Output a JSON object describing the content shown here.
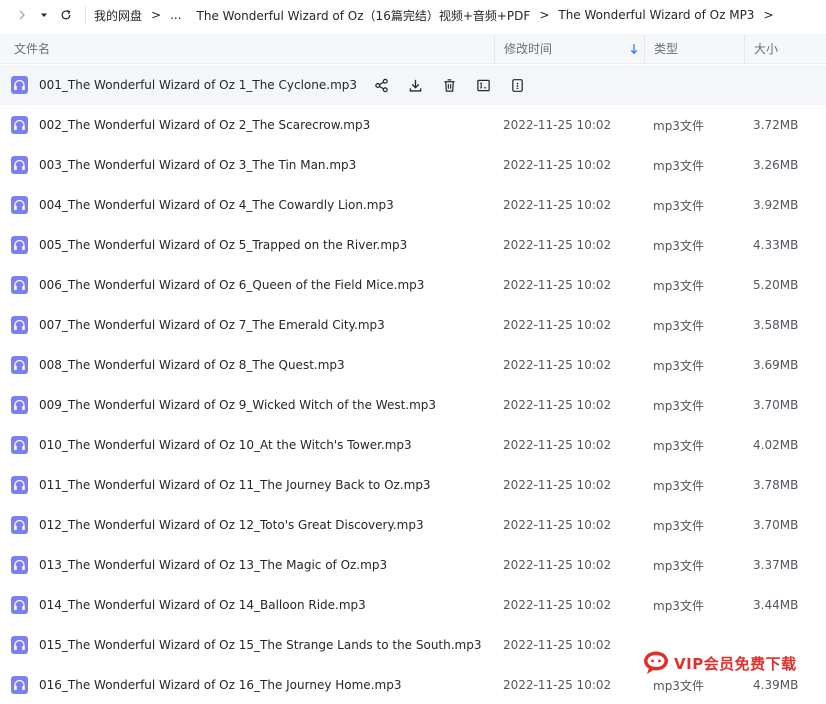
{
  "breadcrumb": {
    "root": "我的网盘",
    "ellipsis": "...",
    "parent": "The Wonderful Wizard of Oz（16篇完结）视频+音频+PDF",
    "current": "The Wonderful Wizard of Oz MP3",
    "separator": ">",
    "trailing": ">"
  },
  "columns": {
    "name": "文件名",
    "modified": "修改时间",
    "type": "类型",
    "size": "大小"
  },
  "files": [
    {
      "name": "001_The Wonderful Wizard of Oz 1_The Cyclone.mp3",
      "modified": "",
      "type": "",
      "size": ""
    },
    {
      "name": "002_The Wonderful Wizard of Oz 2_The Scarecrow.mp3",
      "modified": "2022-11-25 10:02",
      "type": "mp3文件",
      "size": "3.72MB"
    },
    {
      "name": "003_The Wonderful Wizard of Oz 3_The Tin Man.mp3",
      "modified": "2022-11-25 10:02",
      "type": "mp3文件",
      "size": "3.26MB"
    },
    {
      "name": "004_The Wonderful Wizard of Oz 4_The Cowardly Lion.mp3",
      "modified": "2022-11-25 10:02",
      "type": "mp3文件",
      "size": "3.92MB"
    },
    {
      "name": "005_The Wonderful Wizard of Oz 5_Trapped on the River.mp3",
      "modified": "2022-11-25 10:02",
      "type": "mp3文件",
      "size": "4.33MB"
    },
    {
      "name": "006_The Wonderful Wizard of Oz 6_Queen of the Field Mice.mp3",
      "modified": "2022-11-25 10:02",
      "type": "mp3文件",
      "size": "5.20MB"
    },
    {
      "name": "007_The Wonderful Wizard of Oz 7_The Emerald City.mp3",
      "modified": "2022-11-25 10:02",
      "type": "mp3文件",
      "size": "3.58MB"
    },
    {
      "name": "008_The Wonderful Wizard of Oz 8_The Quest.mp3",
      "modified": "2022-11-25 10:02",
      "type": "mp3文件",
      "size": "3.69MB"
    },
    {
      "name": "009_The Wonderful Wizard of Oz 9_Wicked Witch of the West.mp3",
      "modified": "2022-11-25 10:02",
      "type": "mp3文件",
      "size": "3.70MB"
    },
    {
      "name": "010_The Wonderful Wizard of Oz 10_At the Witch's Tower.mp3",
      "modified": "2022-11-25 10:02",
      "type": "mp3文件",
      "size": "4.02MB"
    },
    {
      "name": "011_The Wonderful Wizard of Oz 11_The Journey Back to Oz.mp3",
      "modified": "2022-11-25 10:02",
      "type": "mp3文件",
      "size": "3.78MB"
    },
    {
      "name": "012_The Wonderful Wizard of Oz 12_Toto's Great Discovery.mp3",
      "modified": "2022-11-25 10:02",
      "type": "mp3文件",
      "size": "3.70MB"
    },
    {
      "name": "013_The Wonderful Wizard of Oz 13_The Magic of Oz.mp3",
      "modified": "2022-11-25 10:02",
      "type": "mp3文件",
      "size": "3.37MB"
    },
    {
      "name": "014_The Wonderful Wizard of Oz 14_Balloon Ride.mp3",
      "modified": "2022-11-25 10:02",
      "type": "mp3文件",
      "size": "3.44MB"
    },
    {
      "name": "015_The Wonderful Wizard of Oz 15_The Strange Lands to the South.mp3",
      "modified": "2022-11-25 10:02",
      "type": "",
      "size": ""
    },
    {
      "name": "016_The Wonderful Wizard of Oz 16_The Journey Home.mp3",
      "modified": "2022-11-25 10:02",
      "type": "mp3文件",
      "size": "4.39MB"
    }
  ],
  "row_actions": [
    "share-icon",
    "download-icon",
    "delete-icon",
    "rename-icon",
    "more-icon"
  ],
  "watermark": {
    "text": "VIP会员免费下载"
  },
  "colors": {
    "file_icon": "#7b7ff0",
    "accent": "#2a7fff",
    "watermark": "#e0302a"
  }
}
